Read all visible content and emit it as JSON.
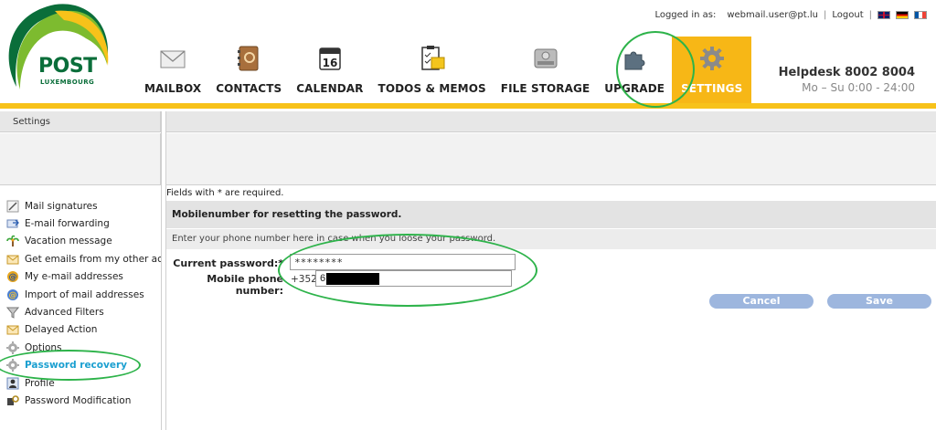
{
  "logo": {
    "name": "POST",
    "sub": "LUXEMBOURG"
  },
  "topbar": {
    "logged_in_label": "Logged in as:",
    "user": "webmail.user@pt.lu",
    "logout": "Logout",
    "separator": "|"
  },
  "nav": {
    "items": [
      {
        "label": "MAILBOX",
        "icon": "envelope-icon"
      },
      {
        "label": "CONTACTS",
        "icon": "address-book-icon"
      },
      {
        "label": "CALENDAR",
        "icon": "calendar-icon",
        "day": "16"
      },
      {
        "label": "TODOS & MEMOS",
        "icon": "todo-clipboard-icon"
      },
      {
        "label": "FILE STORAGE",
        "icon": "hard-drive-icon"
      },
      {
        "label": "UPGRADE",
        "icon": "puzzle-icon"
      },
      {
        "label": "SETTINGS",
        "icon": "gear-icon"
      }
    ],
    "active": "SETTINGS"
  },
  "helpdesk": {
    "line1": "Helpdesk 8002 8004",
    "line2": "Mo – Su 0:00 - 24:00"
  },
  "breadcrumb": "Settings",
  "sidebar": {
    "items": [
      {
        "label": "Mail signatures",
        "icon": "pen-icon"
      },
      {
        "label": "E-mail forwarding",
        "icon": "forward-mail-icon"
      },
      {
        "label": "Vacation message",
        "icon": "palm-tree-icon"
      },
      {
        "label": "Get emails from my other accounts",
        "icon": "fetch-mail-icon"
      },
      {
        "label": "My e-mail addresses",
        "icon": "email-address-icon"
      },
      {
        "label": "Import of mail addresses",
        "icon": "import-address-icon"
      },
      {
        "label": "Advanced Filters",
        "icon": "filter-icon"
      },
      {
        "label": "Delayed Action",
        "icon": "delayed-mail-icon"
      },
      {
        "label": "Options",
        "icon": "options-gear-icon"
      },
      {
        "label": "Password recovery",
        "icon": "recovery-gear-icon"
      },
      {
        "label": "Profile",
        "icon": "profile-icon"
      },
      {
        "label": "Password Modification",
        "icon": "key-icon"
      }
    ],
    "active": "Password recovery"
  },
  "main": {
    "required_note": "Fields with * are required.",
    "section_title": "Mobilenumber for resetting the password.",
    "section_desc": "Enter your phone number here in case when you loose your password.",
    "current_password_label": "Current password:*",
    "current_password_value": "********",
    "mobile_label": "Mobile phone number:",
    "mobile_prefix": "+352",
    "mobile_value": "6",
    "cancel_label": "Cancel",
    "save_label": "Save"
  },
  "colors": {
    "accent": "#f7b716",
    "link": "#1a9fd0",
    "button": "#9db6de",
    "annotation": "#2db34a"
  }
}
